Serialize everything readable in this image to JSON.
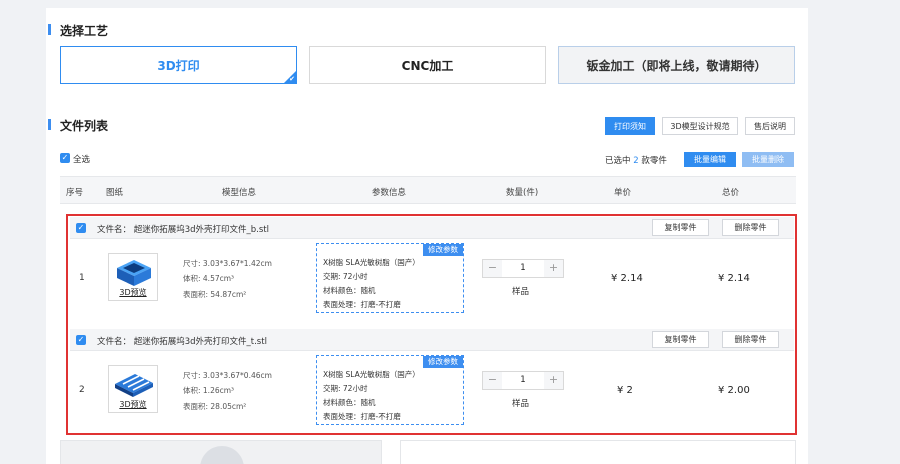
{
  "craft": {
    "title": "选择工艺",
    "options": [
      "3D打印",
      "CNC加工",
      "钣金加工（即将上线，敬请期待）"
    ],
    "selected_check": "✔"
  },
  "files": {
    "title": "文件列表",
    "buttons": [
      "打印须知",
      "3D模型设计规范",
      "售后说明"
    ],
    "select_all": "全选",
    "selected_prefix": "已选中",
    "selected_count": "2",
    "selected_suffix": "款零件",
    "batch_edit": "批量编辑",
    "batch_delete": "批量删除"
  },
  "table": {
    "headers": [
      "序号",
      "图纸",
      "模型信息",
      "参数信息",
      "数量(件)",
      "单价",
      "总价"
    ]
  },
  "parts": [
    {
      "index": "1",
      "file_label": "文件名：",
      "file_name": "超迷你拓展坞3d外壳打印文件_b.stl",
      "copy": "复制零件",
      "delete": "删除零件",
      "preview": "3D预览",
      "size": "尺寸: 3.03*3.67*1.42cm",
      "volume": "体积: 4.57cm³",
      "area": "表面积: 54.87cm²",
      "modify_params": "修改参数",
      "material": "X树脂    SLA光敏树脂（国产）",
      "lead_time": "交期:    72小时",
      "color": "材料颜色：随机",
      "surface": "表面处理：打磨-不打磨",
      "minus": "−",
      "quantity": "1",
      "plus": "+",
      "sample": "样品",
      "unit_price": "¥ 2.14",
      "total_price": "¥ 2.14"
    },
    {
      "index": "2",
      "file_label": "文件名：",
      "file_name": "超迷你拓展坞3d外壳打印文件_t.stl",
      "copy": "复制零件",
      "delete": "删除零件",
      "preview": "3D预览",
      "size": "尺寸: 3.03*3.67*0.46cm",
      "volume": "体积: 1.26cm³",
      "area": "表面积: 28.05cm²",
      "modify_params": "修改参数",
      "material": "X树脂    SLA光敏树脂（国产）",
      "lead_time": "交期:    72小时",
      "color": "材料颜色：随机",
      "surface": "表面处理：打磨-不打磨",
      "minus": "−",
      "quantity": "1",
      "plus": "+",
      "sample": "样品",
      "unit_price": "¥ 2",
      "total_price": "¥ 2.00"
    }
  ],
  "colors": {
    "accent": "#2f8cf0",
    "highlight_border": "#e03232"
  }
}
